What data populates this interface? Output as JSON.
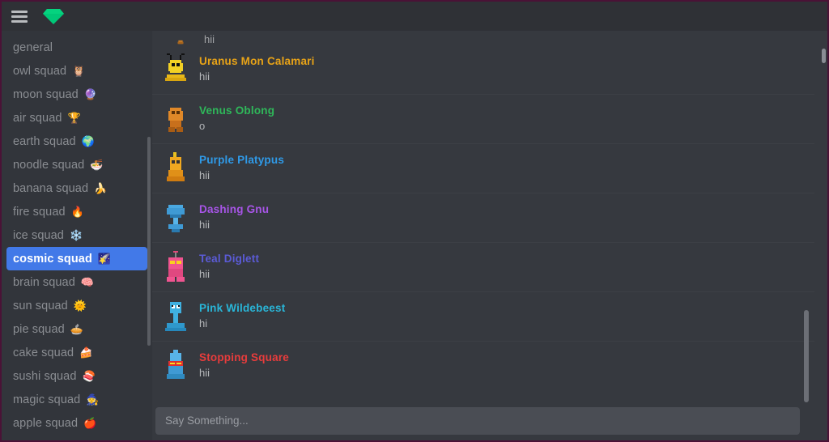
{
  "app": {
    "logo_icon": "green-gem-icon",
    "menu_icon": "hamburger-menu-icon",
    "accent_color": "#00c878",
    "active_channel_color": "#4279e8"
  },
  "sidebar": {
    "channels": [
      {
        "label": "general",
        "emoji": "",
        "active": false
      },
      {
        "label": "owl squad",
        "emoji": "🦉",
        "active": false
      },
      {
        "label": "moon squad",
        "emoji": "🔮",
        "active": false
      },
      {
        "label": "air squad",
        "emoji": "🏆",
        "active": false
      },
      {
        "label": "earth squad",
        "emoji": "🌍",
        "active": false
      },
      {
        "label": "noodle squad",
        "emoji": "🍜",
        "active": false
      },
      {
        "label": "banana squad",
        "emoji": "🍌",
        "active": false
      },
      {
        "label": "fire squad",
        "emoji": "🔥",
        "active": false
      },
      {
        "label": "ice squad",
        "emoji": "❄️",
        "active": false
      },
      {
        "label": "cosmic squad",
        "emoji": "🌠",
        "active": true
      },
      {
        "label": "brain squad",
        "emoji": "🧠",
        "active": false
      },
      {
        "label": "sun squad",
        "emoji": "🌞",
        "active": false
      },
      {
        "label": "pie squad",
        "emoji": "🥧",
        "active": false
      },
      {
        "label": "cake squad",
        "emoji": "🍰",
        "active": false
      },
      {
        "label": "sushi squad",
        "emoji": "🍣",
        "active": false
      },
      {
        "label": "magic squad",
        "emoji": "🧙",
        "active": false
      },
      {
        "label": "apple squad",
        "emoji": "🍎",
        "active": false
      }
    ]
  },
  "chat": {
    "clipped_top_message": {
      "text": "hii"
    },
    "messages": [
      {
        "author": "Uranus Mon Calamari",
        "color": "#e8a317",
        "text": "hii",
        "avatar": "yellow-bug-avatar"
      },
      {
        "author": "Venus Oblong",
        "color": "#2fb85a",
        "text": "o",
        "avatar": "orange-blob-avatar"
      },
      {
        "author": "Purple Platypus",
        "color": "#2f9ae8",
        "text": "hii",
        "avatar": "orange-chick-avatar"
      },
      {
        "author": "Dashing Gnu",
        "color": "#a855e8",
        "text": "hii",
        "avatar": "blue-bulb-avatar"
      },
      {
        "author": "Teal Diglett",
        "color": "#5b5bd6",
        "text": "hii",
        "avatar": "pink-creature-avatar"
      },
      {
        "author": "Pink Wildebeest",
        "color": "#29b6d8",
        "text": "hi",
        "avatar": "blue-snake-avatar"
      },
      {
        "author": "Stopping Square",
        "color": "#e83c3c",
        "text": "hii",
        "avatar": "blue-bottle-avatar"
      }
    ]
  },
  "composer": {
    "placeholder": "Say Something...",
    "value": ""
  }
}
